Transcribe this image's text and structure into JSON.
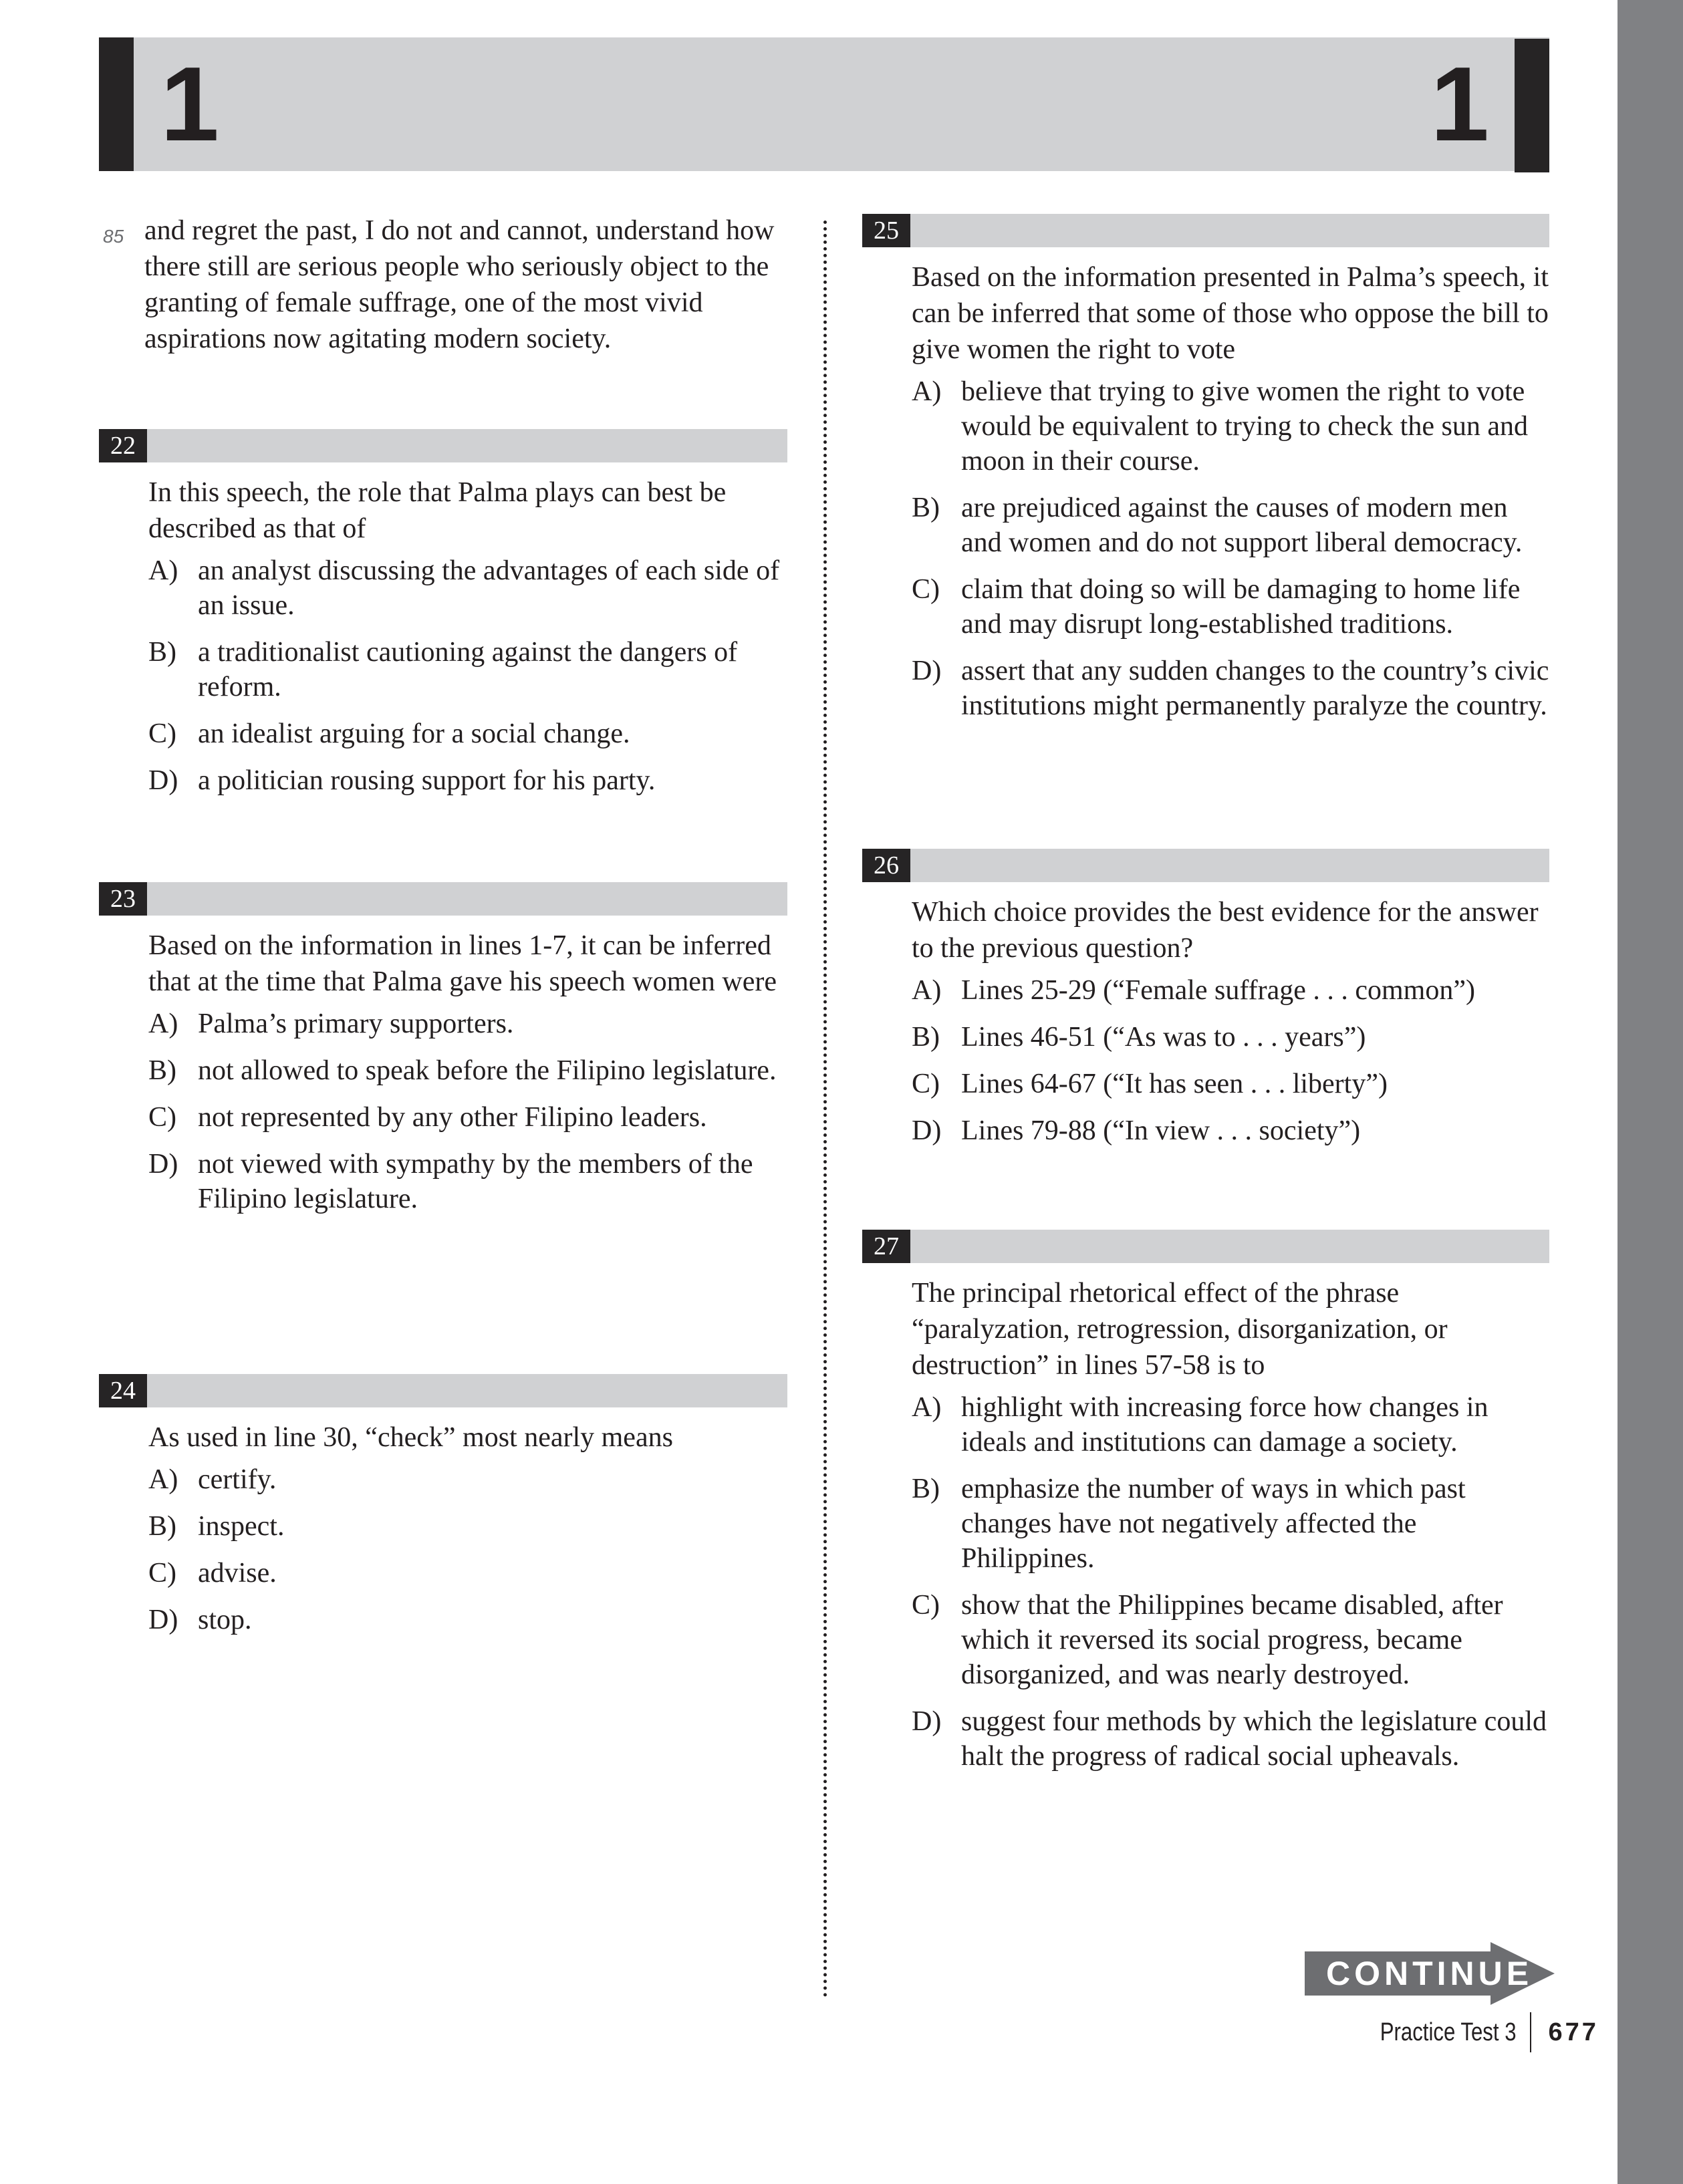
{
  "section": {
    "number_left": "1",
    "number_right": "1"
  },
  "passage": {
    "line_number": "85",
    "text": "and regret the past, I do not and cannot, understand how there still are serious people who seriously object to the granting of female suffrage, one of the most vivid aspirations now agitating modern society."
  },
  "questions": [
    {
      "number": "22",
      "stem": "In this speech, the role that Palma plays can best be described as that of",
      "choices": [
        {
          "letter": "A)",
          "text": "an analyst discussing the advantages of each side of an issue."
        },
        {
          "letter": "B)",
          "text": "a traditionalist cautioning against the dangers of reform."
        },
        {
          "letter": "C)",
          "text": "an idealist arguing for a social change."
        },
        {
          "letter": "D)",
          "text": "a politician rousing support for his party."
        }
      ]
    },
    {
      "number": "23",
      "stem": "Based on the information in lines 1-7, it can be inferred that at the time that Palma gave his speech women were",
      "choices": [
        {
          "letter": "A)",
          "text": "Palma’s primary supporters."
        },
        {
          "letter": "B)",
          "text": "not allowed to speak before the Filipino legislature."
        },
        {
          "letter": "C)",
          "text": "not represented by any other Filipino leaders."
        },
        {
          "letter": "D)",
          "text": "not viewed with sympathy by the members of the Filipino legislature."
        }
      ]
    },
    {
      "number": "24",
      "stem": "As used in line 30, “check” most nearly means",
      "choices": [
        {
          "letter": "A)",
          "text": "certify."
        },
        {
          "letter": "B)",
          "text": "inspect."
        },
        {
          "letter": "C)",
          "text": "advise."
        },
        {
          "letter": "D)",
          "text": "stop."
        }
      ]
    },
    {
      "number": "25",
      "stem": "Based on the information presented in Palma’s speech, it can be inferred that some of those who oppose the bill to give women the right to vote",
      "choices": [
        {
          "letter": "A)",
          "text": "believe that trying to give women the right to vote would be equivalent to trying to check the sun and moon in their course."
        },
        {
          "letter": "B)",
          "text": "are prejudiced against the causes of modern men and women and do not support liberal democracy."
        },
        {
          "letter": "C)",
          "text": "claim that doing so will be damaging to home life and may disrupt long-established traditions."
        },
        {
          "letter": "D)",
          "text": "assert that any sudden changes to the country’s civic institutions might permanently paralyze the country."
        }
      ]
    },
    {
      "number": "26",
      "stem": "Which choice provides the best evidence for the answer to the previous question?",
      "choices": [
        {
          "letter": "A)",
          "text": "Lines 25-29 (“Female suffrage . . . common”)"
        },
        {
          "letter": "B)",
          "text": "Lines 46-51 (“As was to . . . years”)"
        },
        {
          "letter": "C)",
          "text": "Lines 64-67 (“It has seen . . . liberty”)"
        },
        {
          "letter": "D)",
          "text": "Lines 79-88 (“In view . . . society”)"
        }
      ]
    },
    {
      "number": "27",
      "stem": "The principal rhetorical effect of the phrase “paralyzation, retrogression, disorganization, or destruction” in lines 57-58 is to",
      "choices": [
        {
          "letter": "A)",
          "text": "highlight with increasing force how changes in ideals and institutions can damage a society."
        },
        {
          "letter": "B)",
          "text": "emphasize the number of ways in which past changes have not negatively affected the Philippines."
        },
        {
          "letter": "C)",
          "text": "show that the Philippines became disabled, after which it reversed its social progress, became disorganized, and was nearly destroyed."
        },
        {
          "letter": "D)",
          "text": "suggest four methods by which the legislature could halt the progress of radical social upheavals."
        }
      ]
    }
  ],
  "continue": {
    "label": "CONTINUE",
    "icon": "arrow-right-icon"
  },
  "footer": {
    "test_label": "Practice Test 3",
    "page_number": "677"
  },
  "colors": {
    "bar_gray": "#d0d1d3",
    "dark": "#262425",
    "side_tab": "#808184",
    "continue_fill": "#6d6e71"
  }
}
